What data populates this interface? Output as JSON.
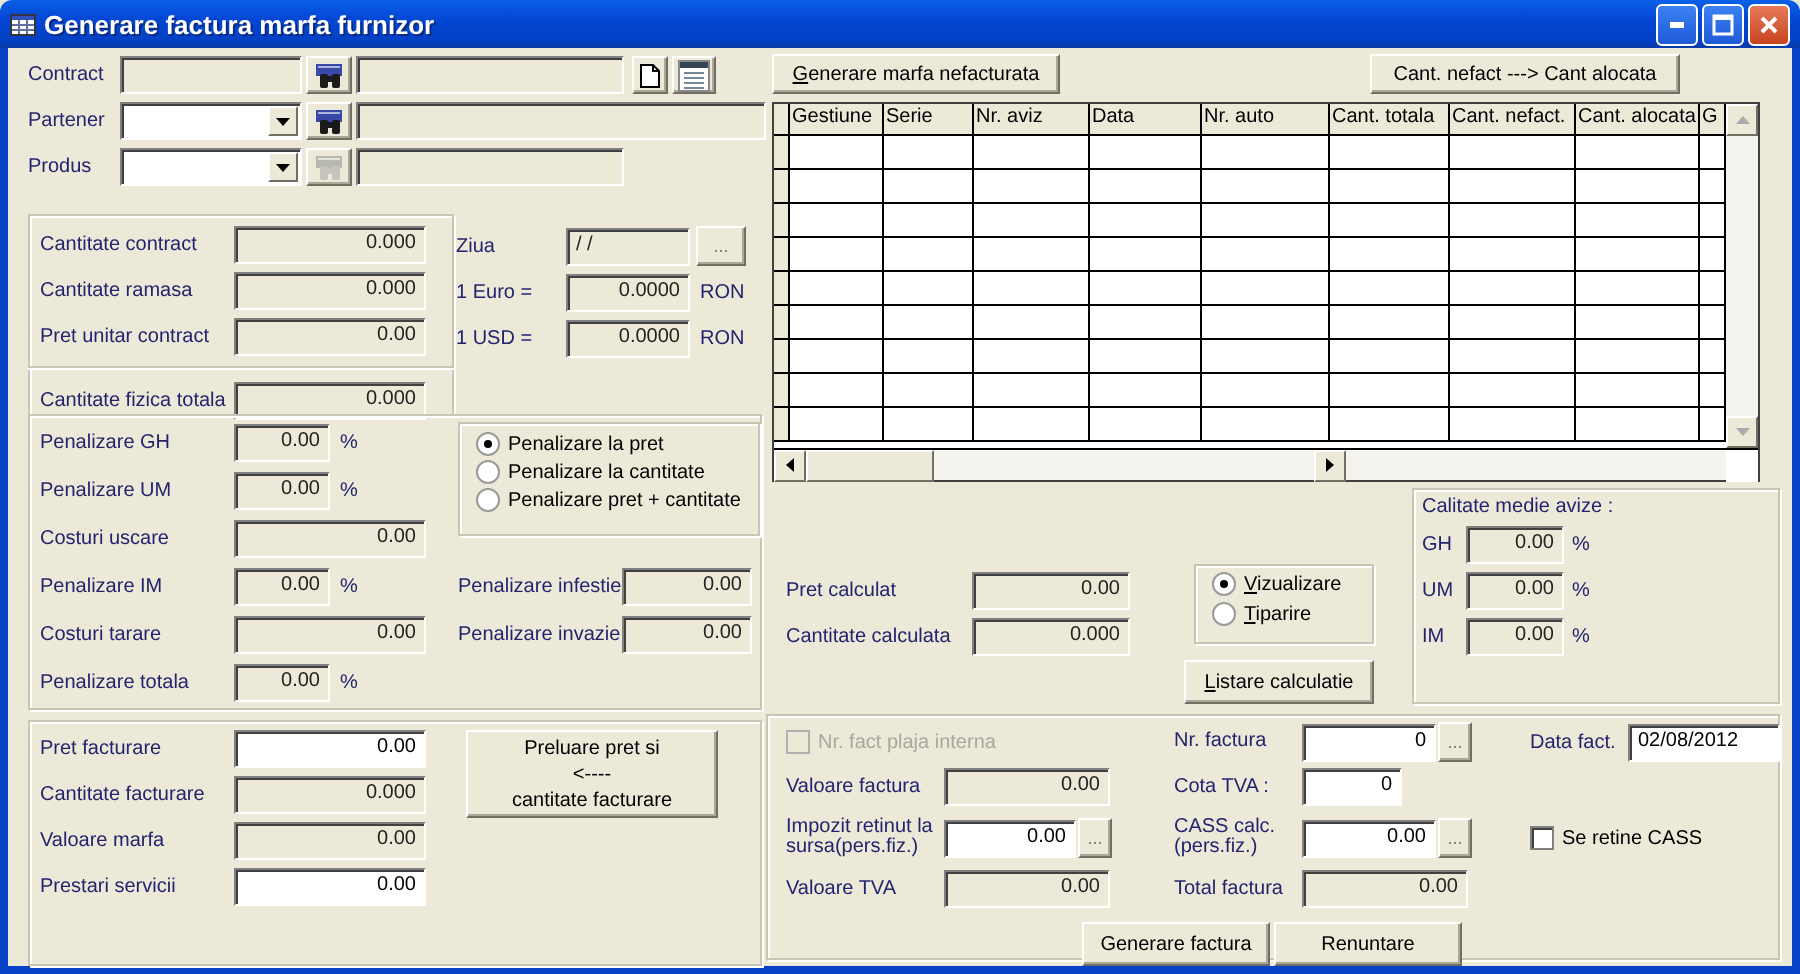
{
  "window": {
    "title": "Generare factura marfa furnizor"
  },
  "selection": [
    {
      "label": "Contract",
      "kind": "text",
      "search_disabled": false,
      "extra_buttons": true,
      "wide_detail": false
    },
    {
      "label": "Partener",
      "kind": "combo",
      "search_disabled": false,
      "extra_buttons": false,
      "wide_detail": true
    },
    {
      "label": "Produs",
      "kind": "combo",
      "search_disabled": true,
      "extra_buttons": false,
      "wide_detail": false
    }
  ],
  "contract_info": {
    "rows": [
      {
        "label": "Cantitate contract",
        "value": "0.000"
      },
      {
        "label": "Cantitate ramasa",
        "value": "0.000"
      },
      {
        "label": "Pret unitar contract",
        "value": "0.00"
      }
    ],
    "total": {
      "label": "Cantitate fizica totala",
      "value": "0.000"
    }
  },
  "rates": {
    "day": {
      "label": "Ziua",
      "value": "/ /",
      "button": "..."
    },
    "rows": [
      {
        "label": "1 Euro =",
        "value": "0.0000",
        "unit": "RON"
      },
      {
        "label": "1 USD =",
        "value": "0.0000",
        "unit": "RON"
      }
    ]
  },
  "penalties": {
    "options": [
      {
        "label": "Penalizare la pret",
        "selected": true
      },
      {
        "label": "Penalizare la cantitate",
        "selected": false
      },
      {
        "label": "Penalizare pret + cantitate",
        "selected": false
      }
    ],
    "rows": [
      {
        "label": "Penalizare GH",
        "value": "0.00",
        "unit": "%"
      },
      {
        "label": "Penalizare UM",
        "value": "0.00",
        "unit": "%"
      },
      {
        "label": "Costuri uscare",
        "value": "0.00"
      },
      {
        "label": "Penalizare IM",
        "value": "0.00",
        "unit": "%",
        "side": {
          "label": "Penalizare infestie",
          "value": "0.00"
        }
      },
      {
        "label": "Costuri tarare",
        "value": "0.00",
        "side": {
          "label": "Penalizare invazie",
          "value": "0.00"
        }
      },
      {
        "label": "Penalizare totala",
        "value": "0.00",
        "unit": "%"
      }
    ]
  },
  "billing": {
    "rows": [
      {
        "label": "Pret facturare",
        "value": "0.00",
        "editable": true
      },
      {
        "label": "Cantitate facturare",
        "value": "0.000",
        "editable": false
      },
      {
        "label": "Valoare marfa",
        "value": "0.00",
        "editable": false
      },
      {
        "label": "Prestari servicii",
        "value": "0.00",
        "editable": true
      }
    ],
    "button": {
      "label": "Preluare pret si\n<----\ncantitate facturare"
    }
  },
  "actions": [
    {
      "label": "Generare marfa nefacturata",
      "access_key": true
    },
    {
      "label": "Cant. nefact ---> Cant alocata",
      "access_key": false
    }
  ],
  "grid": {
    "columns": [
      "Gestiune",
      "Serie",
      "Nr. aviz",
      "Data",
      "Nr. auto",
      "Cant. totala",
      "Cant. nefact.",
      "Cant. alocata",
      "G"
    ]
  },
  "calculation": {
    "rows": [
      {
        "label": "Pret calculat",
        "value": "0.00"
      },
      {
        "label": "Cantitate calculata",
        "value": "0.000"
      }
    ],
    "output": [
      {
        "label": "Vizualizare",
        "selected": true,
        "access_key": true
      },
      {
        "label": "Tiparire",
        "selected": false,
        "access_key": true
      }
    ],
    "button": {
      "label": "Listare calculatie",
      "access_key": true
    }
  },
  "quality": {
    "title": "Calitate medie avize :",
    "rows": [
      {
        "label": "GH",
        "value": "0.00",
        "unit": "%"
      },
      {
        "label": "UM",
        "value": "0.00",
        "unit": "%"
      },
      {
        "label": "IM",
        "value": "0.00",
        "unit": "%"
      }
    ]
  },
  "invoice": {
    "internal_range": {
      "label": "Nr. fact plaja interna",
      "checked": false,
      "disabled": true
    },
    "left": [
      {
        "label": "Valoare factura",
        "value": "0.00",
        "editable": false
      },
      {
        "label": "Impozit retinut la sursa(pers.fiz.)",
        "value": "0.00",
        "editable": true,
        "button": "..."
      },
      {
        "label": "Valoare TVA",
        "value": "0.00",
        "editable": false
      }
    ],
    "middle": [
      {
        "label": "Nr. factura",
        "value": "0",
        "editable": true,
        "button": "..."
      },
      {
        "label": "Cota TVA :",
        "value": "0",
        "editable": true
      },
      {
        "label": "CASS calc. (pers.fiz.)",
        "value": "0.00",
        "editable": true,
        "button": "..."
      },
      {
        "label": "Total factura",
        "value": "0.00",
        "editable": false
      }
    ],
    "date": {
      "label": "Data fact.",
      "value": "02/08/2012"
    },
    "cass": {
      "label": "Se retine CASS",
      "checked": false
    },
    "buttons": [
      {
        "label": "Generare factura"
      },
      {
        "label": "Renuntare"
      }
    ]
  }
}
